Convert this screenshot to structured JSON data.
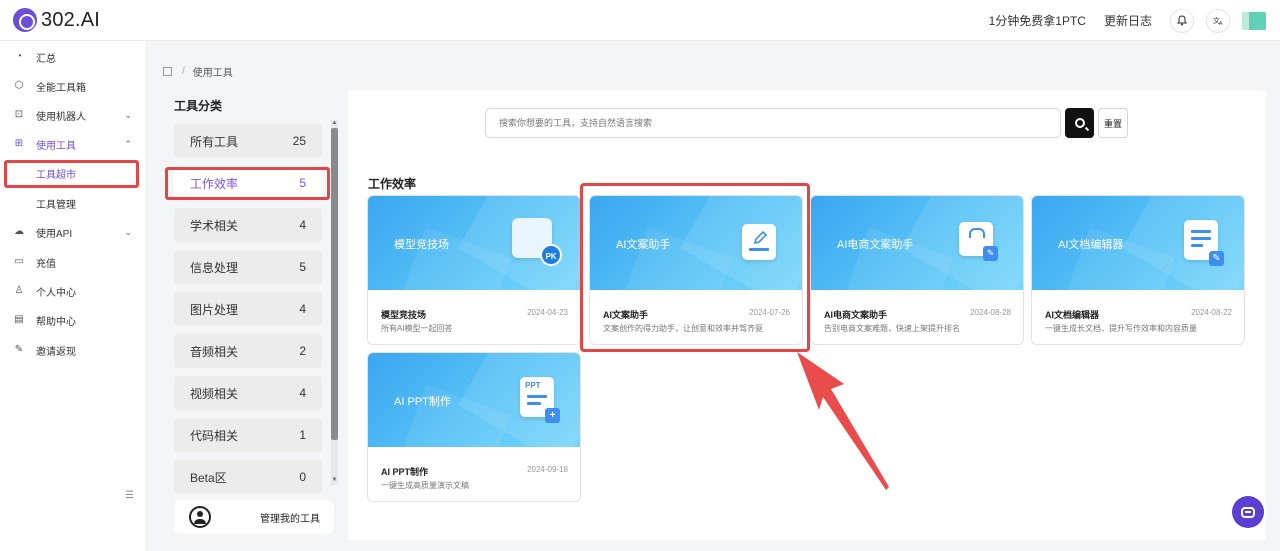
{
  "app": {
    "logo_text": "302.AI"
  },
  "topbar": {
    "promo_link": "1分钟免费拿1PTC",
    "changelog_link": "更新日志",
    "bell_icon": "bell-icon",
    "translate_icon": "translate-icon"
  },
  "sidebar": {
    "items": [
      {
        "label": "汇总",
        "icon": "dashboard-icon"
      },
      {
        "label": "全能工具箱",
        "icon": "cube-icon"
      },
      {
        "label": "使用机器人",
        "icon": "robot-icon"
      },
      {
        "label": "使用工具",
        "icon": "grid-icon"
      },
      {
        "label": "使用API",
        "icon": "cloud-icon"
      },
      {
        "label": "充值",
        "icon": "wallet-icon"
      },
      {
        "label": "个人中心",
        "icon": "user-icon"
      },
      {
        "label": "帮助中心",
        "icon": "book-icon"
      },
      {
        "label": "邀请返现",
        "icon": "gift-icon"
      }
    ],
    "sub_items": [
      {
        "label": "工具超市"
      },
      {
        "label": "工具管理"
      }
    ]
  },
  "breadcrumb": {
    "current": "使用工具"
  },
  "categories": {
    "title": "工具分类",
    "items": [
      {
        "label": "所有工具",
        "count": "25"
      },
      {
        "label": "工作效率",
        "count": "5"
      },
      {
        "label": "学术相关",
        "count": "4"
      },
      {
        "label": "信息处理",
        "count": "5"
      },
      {
        "label": "图片处理",
        "count": "4"
      },
      {
        "label": "音频相关",
        "count": "2"
      },
      {
        "label": "视频相关",
        "count": "4"
      },
      {
        "label": "代码相关",
        "count": "1"
      },
      {
        "label": "Beta区",
        "count": "0"
      }
    ],
    "manage_button": "管理我的工具"
  },
  "search": {
    "placeholder": "搜索你想要的工具，支持自然语言搜索",
    "value": "",
    "reset_label": "重置"
  },
  "section": {
    "title": "工作效率"
  },
  "tools": [
    {
      "banner_title": "模型竞技场",
      "name": "模型竞技场",
      "date": "2024-04-23",
      "desc": "所有AI模型一起回答",
      "badge": "PK"
    },
    {
      "banner_title": "AI文案助手",
      "name": "AI文案助手",
      "date": "2024-07-26",
      "desc": "文案创作的得力助手，让创意和效率并驾齐驱"
    },
    {
      "banner_title": "AI电商文案助手",
      "name": "AI电商文案助手",
      "date": "2024-08-28",
      "desc": "告别电商文案难题，快速上架提升排名"
    },
    {
      "banner_title": "AI文档编辑器",
      "name": "AI文档编辑器",
      "date": "2024-08-22",
      "desc": "一键生成长文档，提升写作效率和内容质量"
    },
    {
      "banner_title": "AI PPT制作",
      "name": "AI PPT制作",
      "date": "2024-09-18",
      "desc": "一键生成高质量演示文稿",
      "badge": "PPT"
    }
  ],
  "colors": {
    "accent": "#6b4fd8",
    "highlight": "#e24646",
    "banner": "#4fb6f4"
  }
}
